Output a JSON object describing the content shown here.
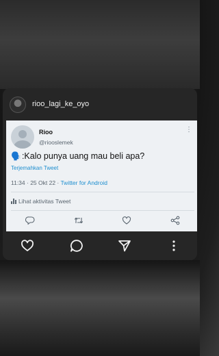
{
  "app": {
    "username": "rioo_lagi_ke_oyo"
  },
  "tweet": {
    "name": "Rioo",
    "handle": "@riooslemek",
    "text": ":Kalo punya uang mau beli apa?",
    "emoji": "🗣️",
    "translate_label": "Terjemahkan Tweet",
    "time": "11:34 · 25 Okt 22 · ",
    "source": "Twitter for Android",
    "activity_label": "Lihat aktivitas Tweet",
    "more": "⋮",
    "actions": [
      "reply-icon",
      "retweet-icon",
      "like-icon",
      "share-icon"
    ]
  },
  "footer": {
    "icons": [
      "heart-icon",
      "comment-icon",
      "send-icon",
      "more-vertical-icon"
    ]
  },
  "colors": {
    "link": "#1d8ecf",
    "card_bg": "#eef1f4",
    "panel_bg": "#262626"
  }
}
